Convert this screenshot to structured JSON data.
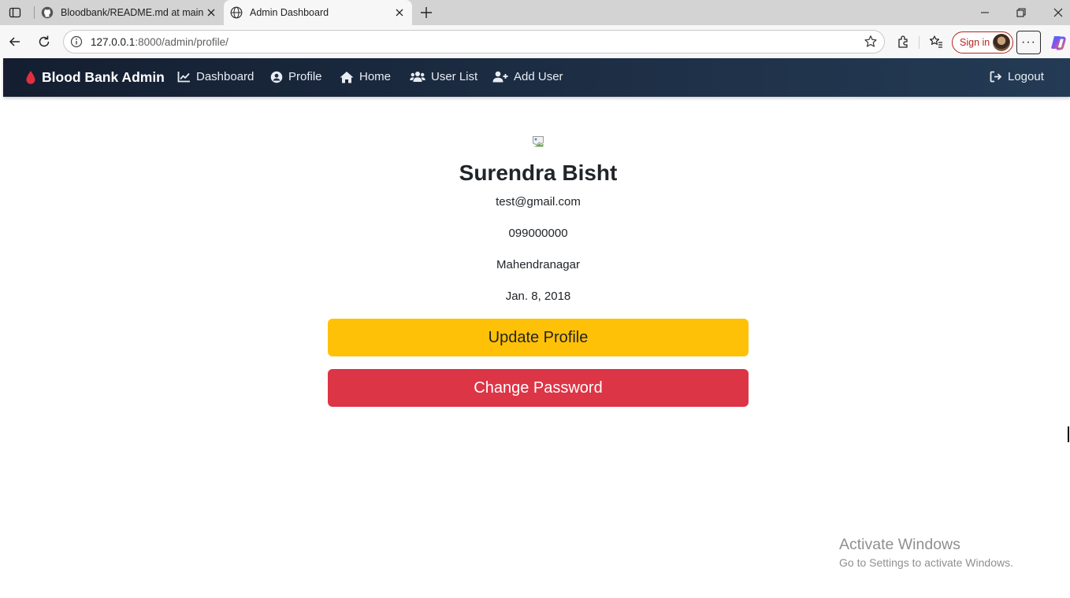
{
  "browser": {
    "tabs": [
      {
        "title": "Bloodbank/README.md at main ·",
        "favicon": "github-icon",
        "active": false
      },
      {
        "title": "Admin Dashboard",
        "favicon": "globe-icon",
        "active": true
      }
    ],
    "address": {
      "host": "127.0.0.1",
      "path": ":8000/admin/profile/"
    },
    "signin_label": "Sign in",
    "more_label": "···"
  },
  "navbar": {
    "brand": "Blood Bank Admin",
    "items": [
      {
        "label": "Dashboard",
        "icon": "chart-line-icon"
      },
      {
        "label": "Profile",
        "icon": "user-circle-icon"
      },
      {
        "label": "Home",
        "icon": "home-icon"
      },
      {
        "label": "User List",
        "icon": "users-icon"
      },
      {
        "label": "Add User",
        "icon": "user-plus-icon"
      }
    ],
    "logout": {
      "label": "Logout",
      "icon": "sign-out-icon"
    }
  },
  "profile": {
    "name": "Surendra Bisht",
    "email": "test@gmail.com",
    "phone": "099000000",
    "address": "Mahendranagar",
    "date": "Jan. 8, 2018"
  },
  "actions": {
    "update_label": "Update Profile",
    "password_label": "Change Password"
  },
  "watermark": {
    "title": "Activate Windows",
    "subtitle": "Go to Settings to activate Windows."
  },
  "colors": {
    "navbar_start": "#141e30",
    "navbar_end": "#243b55",
    "update_button": "#ffc107",
    "password_button": "#dc3545",
    "brand_drop": "#e0303e"
  }
}
